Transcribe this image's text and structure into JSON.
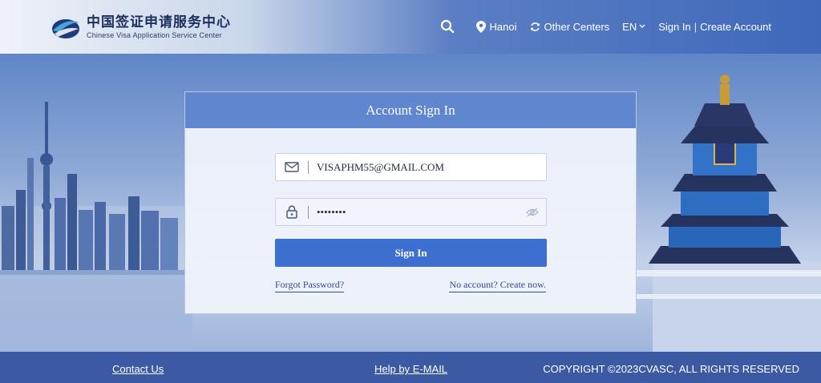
{
  "header": {
    "logo_cn": "中国签证申请服务中心",
    "logo_en": "Chinese Visa Application Service Center",
    "location": "Hanoi",
    "other_centers": "Other Centers",
    "language": "EN",
    "sign_in": "Sign In",
    "separator": "|",
    "create_account": "Create Account"
  },
  "card": {
    "title": "Account Sign In",
    "email_value": "VISAPHM55@GMAIL.COM",
    "password_mask": "••••••••",
    "sign_in_button": "Sign In",
    "forgot_password": "Forgot Password?",
    "create_now": "No account? Create now."
  },
  "footer": {
    "contact": "Contact Us",
    "help": "Help by E-MAIL",
    "copyright": "COPYRIGHT ©2023CVASC, ALL RIGHTS RESERVED"
  },
  "icons": {
    "search": "search-icon",
    "location": "map-pin-icon",
    "refresh": "refresh-icon",
    "chevron": "chevron-down-icon",
    "mail": "mail-icon",
    "lock": "lock-icon",
    "eye": "eye-icon"
  },
  "colors": {
    "header_accent": "#3f68bb",
    "card_header": "#5f86cf",
    "button": "#3d6fd0",
    "footer": "#3b5aa3",
    "link": "#2d4e98"
  }
}
